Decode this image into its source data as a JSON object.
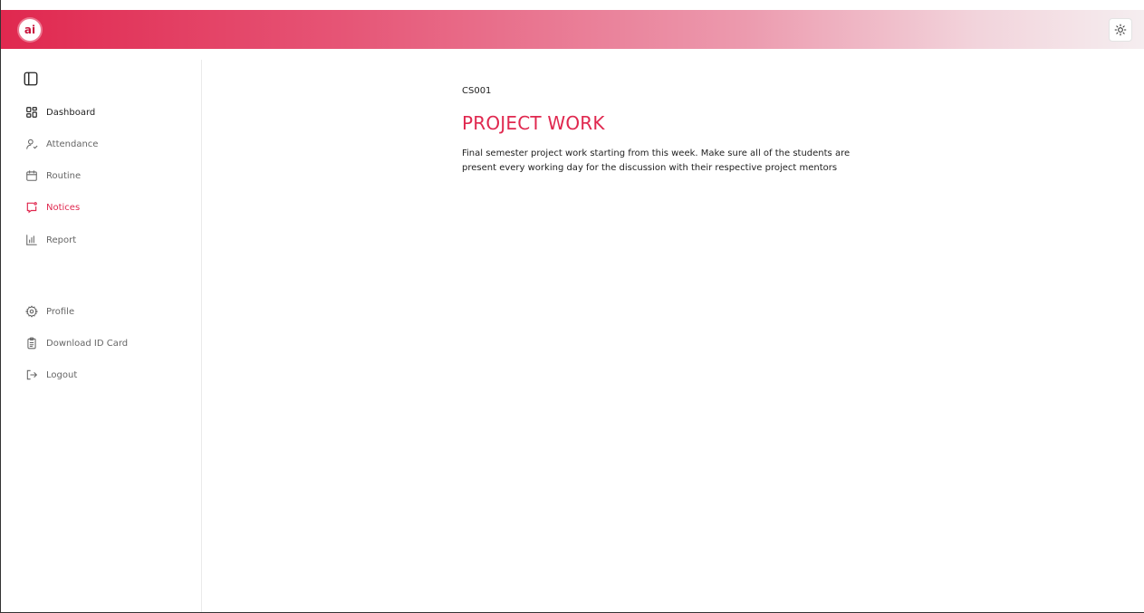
{
  "header": {
    "logo_text": "ai",
    "theme_toggle_icon": "sun-icon",
    "gradient": [
      "#e0284f",
      "#f5eef0"
    ]
  },
  "sidebar": {
    "collapse_icon": "sidebar-toggle-icon",
    "items": [
      {
        "label": "Dashboard",
        "icon": "grid-icon"
      },
      {
        "label": "Attendance",
        "icon": "user-icon"
      },
      {
        "label": "Routine",
        "icon": "calendar-icon"
      },
      {
        "label": "Notices",
        "icon": "message-icon"
      },
      {
        "label": "Report",
        "icon": "bar-chart-icon"
      },
      {
        "label": "Profile",
        "icon": "gear-icon"
      },
      {
        "label": "Download ID Card",
        "icon": "clipboard-icon"
      },
      {
        "label": "Logout",
        "icon": "logout-icon"
      }
    ],
    "active_label": "Notices",
    "accent_color": "#e0284f"
  },
  "notice": {
    "code": "CS001",
    "title": "PROJECT WORK",
    "description": "Final semester project work starting from this week. Make sure all of the students are present every working day for the discussion with their respective project mentors"
  }
}
